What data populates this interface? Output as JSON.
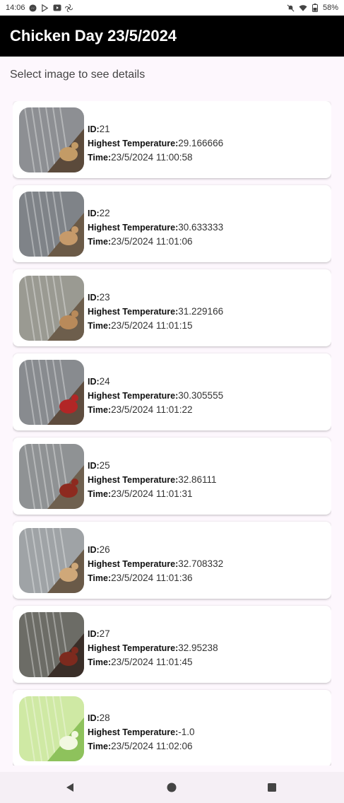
{
  "status_bar": {
    "time": "14:06",
    "battery": "58%",
    "left_icons": [
      "messenger-icon",
      "play-store-icon",
      "youtube-icon",
      "fan-icon"
    ],
    "right_icons": [
      "mute-icon",
      "wifi-icon",
      "battery-icon"
    ]
  },
  "app_bar": {
    "title": "Chicken Day 23/5/2024"
  },
  "subtitle": "Select image to see details",
  "labels": {
    "id": "ID:",
    "temp": "Highest Temperature:",
    "time": "Time:"
  },
  "records": [
    {
      "id": "21",
      "temp": "29.166666",
      "time": "23/5/2024 11:00:58",
      "colors": [
        "#8d8f93",
        "#5b4a3b",
        "#c39b66"
      ]
    },
    {
      "id": "22",
      "temp": "30.633333",
      "time": "23/5/2024 11:01:06",
      "colors": [
        "#7f8388",
        "#6b5a47",
        "#c69a6a"
      ]
    },
    {
      "id": "23",
      "temp": "31.229166",
      "time": "23/5/2024 11:01:15",
      "colors": [
        "#9a9a92",
        "#6d5e4c",
        "#b98a5a"
      ]
    },
    {
      "id": "24",
      "temp": "30.305555",
      "time": "23/5/2024 11:01:22",
      "colors": [
        "#888b8f",
        "#5e4c3e",
        "#b22626"
      ]
    },
    {
      "id": "25",
      "temp": "32.86111",
      "time": "23/5/2024 11:01:31",
      "colors": [
        "#8f9294",
        "#6f604f",
        "#8d2a1f"
      ]
    },
    {
      "id": "26",
      "temp": "32.708332",
      "time": "23/5/2024 11:01:36",
      "colors": [
        "#9fa3a6",
        "#6a5a48",
        "#cfa879"
      ]
    },
    {
      "id": "27",
      "temp": "32.95238",
      "time": "23/5/2024 11:01:45",
      "colors": [
        "#6c6c66",
        "#3a2e28",
        "#7d2a1e"
      ]
    },
    {
      "id": "28",
      "temp": "-1.0",
      "time": "23/5/2024 11:02:06",
      "colors": [
        "#cfe9a4",
        "#8ec25c",
        "#f2f8e1"
      ]
    }
  ],
  "nav": [
    "back-icon",
    "home-icon",
    "recents-icon"
  ]
}
